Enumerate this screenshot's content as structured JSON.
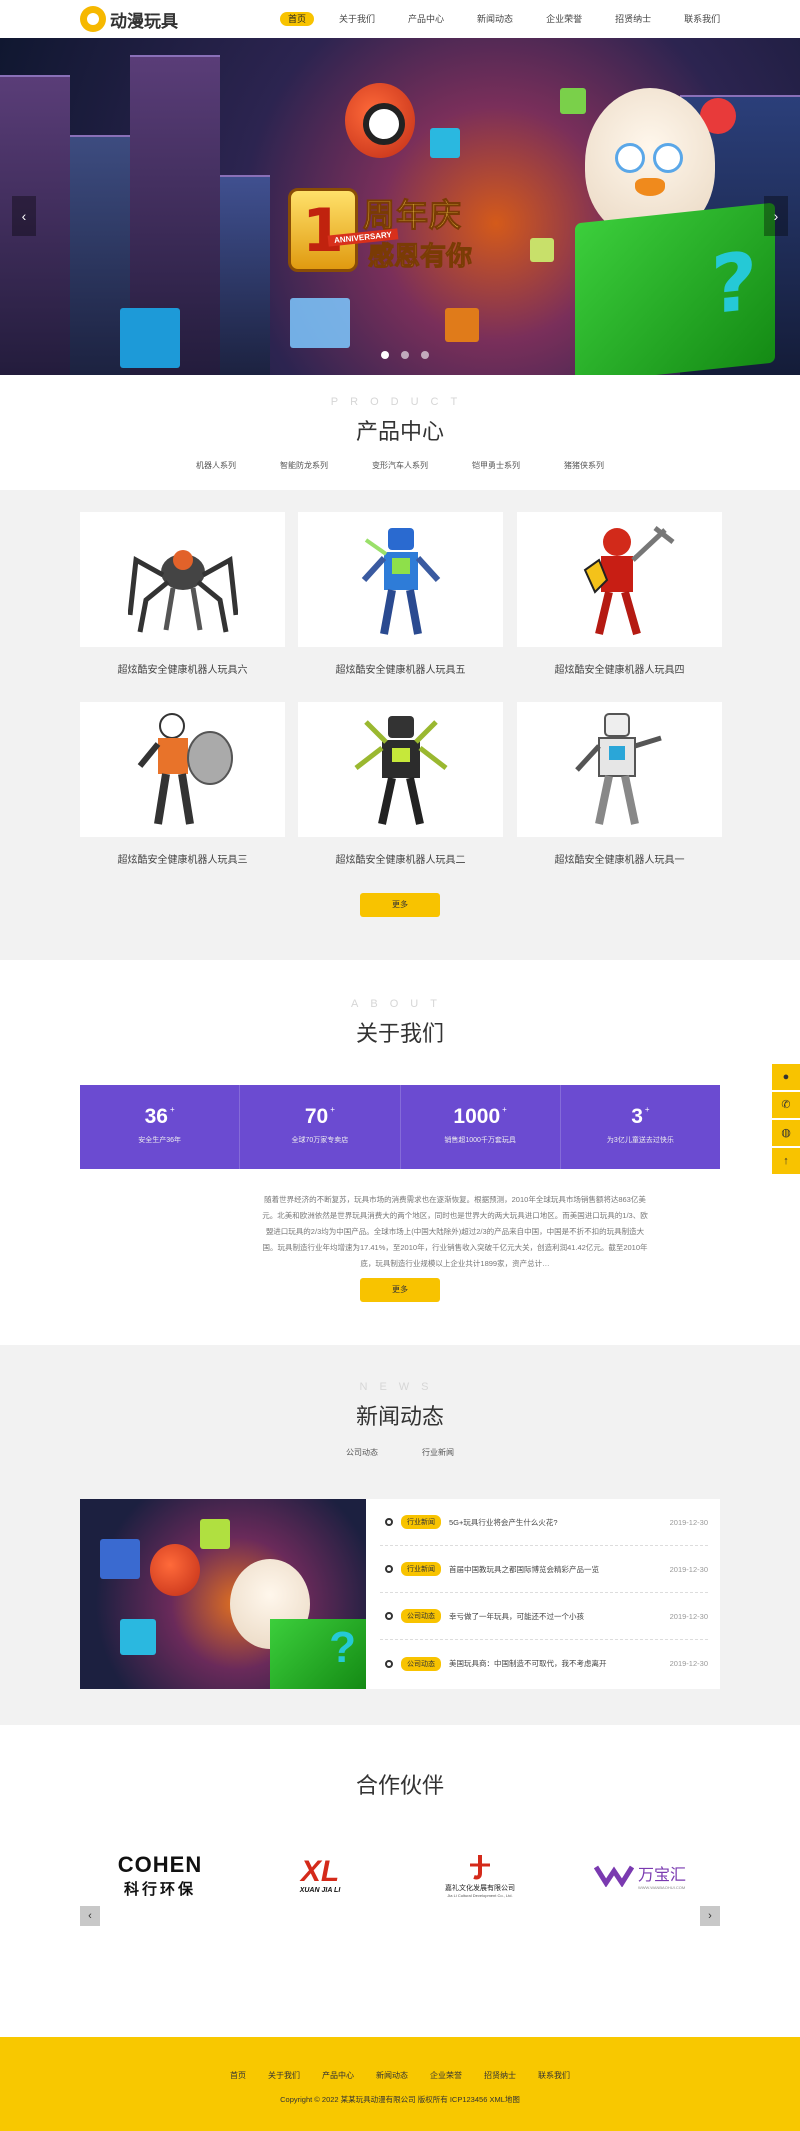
{
  "header": {
    "logo_text": "动漫玩具",
    "nav": [
      "首页",
      "关于我们",
      "产品中心",
      "新闻动态",
      "企业荣誉",
      "招贤纳士",
      "联系我们"
    ]
  },
  "banner": {
    "big_number": "1",
    "headline_1": "周年庆",
    "ribbon": "ANNIVERSARY",
    "headline_2": "感恩有你",
    "prev": "‹",
    "next": "›"
  },
  "product": {
    "en": "PRODUCT",
    "title": "产品中心",
    "tabs": [
      "机器人系列",
      "智能防龙系列",
      "变形汽车人系列",
      "铠甲勇士系列",
      "猪猪侠系列"
    ],
    "items": [
      "超炫酷安全健康机器人玩具六",
      "超炫酷安全健康机器人玩具五",
      "超炫酷安全健康机器人玩具四",
      "超炫酷安全健康机器人玩具三",
      "超炫酷安全健康机器人玩具二",
      "超炫酷安全健康机器人玩具一"
    ],
    "more": "更多"
  },
  "about": {
    "en": "ABOUT",
    "title": "关于我们",
    "stats": [
      {
        "value": "36",
        "suffix": "+",
        "label": "安全生产36年"
      },
      {
        "value": "70",
        "suffix": "+",
        "label": "全球70万家专卖店"
      },
      {
        "value": "1000",
        "suffix": "+",
        "label": "销售超1000千万套玩具"
      },
      {
        "value": "3",
        "suffix": "+",
        "label": "为3亿儿童送去过快乐"
      }
    ],
    "text": "随着世界经济的不断复苏，玩具市场的消费需求也在逐渐恢复。根据预测，2010年全球玩具市场销售额将达863亿美元。北美和欧洲依然是世界玩具消费大的两个地区，同时也是世界大的两大玩具进口地区。而美国进口玩具的1/3、欧盟进口玩具的2/3均为中国产品。全球市场上(中国大陆除外)超过2/3的产品来自中国，中国是不折不扣的玩具制造大国。玩具制造行业年均增速为17.41%，至2010年，行业销售收入突破千亿元大关，创造利润41.42亿元。截至2010年底，玩具制造行业规模以上企业共计1899家，资产总计…",
    "more": "更多"
  },
  "news": {
    "en": "NEWS",
    "title": "新闻动态",
    "tabs": [
      "公司动态",
      "行业新闻"
    ],
    "items": [
      {
        "tag": "行业新闻",
        "title": "5G+玩具行业将会产生什么火花?",
        "date": "2019-12-30"
      },
      {
        "tag": "行业新闻",
        "title": "首届中国教玩具之都国际博览会精彩产品一览",
        "date": "2019-12-30"
      },
      {
        "tag": "公司动态",
        "title": "幸亏做了一年玩具，可能还不过一个小孩",
        "date": "2019-12-30"
      },
      {
        "tag": "公司动态",
        "title": "美国玩具商：中国制造不可取代，我不考虑离开",
        "date": "2019-12-30"
      }
    ]
  },
  "partners": {
    "title": "合作伙伴",
    "items": [
      {
        "line1": "COHEN",
        "line2": "科行环保"
      },
      {
        "line1": "XL",
        "line2": "XUAN JIA LI"
      },
      {
        "line1": "嘉礼文化发展有限公司",
        "line2": "Jia Li Cultural Development Co., Ltd."
      },
      {
        "line1": "万宝汇",
        "line2": "WWW.WANBAOHUI.COM"
      }
    ],
    "prev": "‹",
    "next": "›"
  },
  "side": [
    "qq-icon",
    "phone-icon",
    "wechat-icon",
    "top-icon"
  ],
  "footer": {
    "nav": [
      "首页",
      "关于我们",
      "产品中心",
      "新闻动态",
      "企业荣誉",
      "招贤纳士",
      "联系我们"
    ],
    "copyright": "Copyright © 2022 某某玩具动漫有限公司 版权所有 ICP123456 XML地图"
  },
  "colors": {
    "accent": "#f8c300",
    "stats_bg": "#6b4bd1",
    "footer_bg": "#f8c800"
  }
}
